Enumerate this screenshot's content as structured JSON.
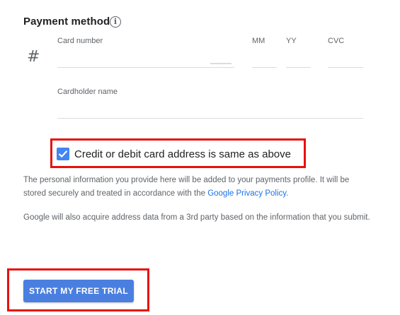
{
  "payment": {
    "title": "Payment method",
    "info_icon": "info-icon",
    "card_icon": "hash-icon",
    "card_icon_glyph": "#",
    "fields": {
      "card_number": {
        "label": "Card number",
        "value": ""
      },
      "mm": {
        "label": "MM",
        "value": ""
      },
      "yy": {
        "label": "YY",
        "value": ""
      },
      "cvc": {
        "label": "CVC",
        "value": ""
      },
      "cardholder_name": {
        "label": "Cardholder name",
        "value": ""
      }
    },
    "same_address": {
      "label": "Credit or debit card address is same as above",
      "checked": true
    }
  },
  "disclaimer": {
    "part1": "The personal information you provide here will be added to your payments profile. It will be stored securely and treated in accordance with the ",
    "link_text": "Google Privacy Policy",
    "part2": "."
  },
  "address_notice": "Google will also acquire address data from a 3rd party based on the information that you submit.",
  "cta": {
    "label": "START MY FREE TRIAL"
  },
  "colors": {
    "accent": "#4285f4",
    "button": "#4a7fe0",
    "link": "#1a73e8",
    "highlight_box": "#e8100d"
  }
}
